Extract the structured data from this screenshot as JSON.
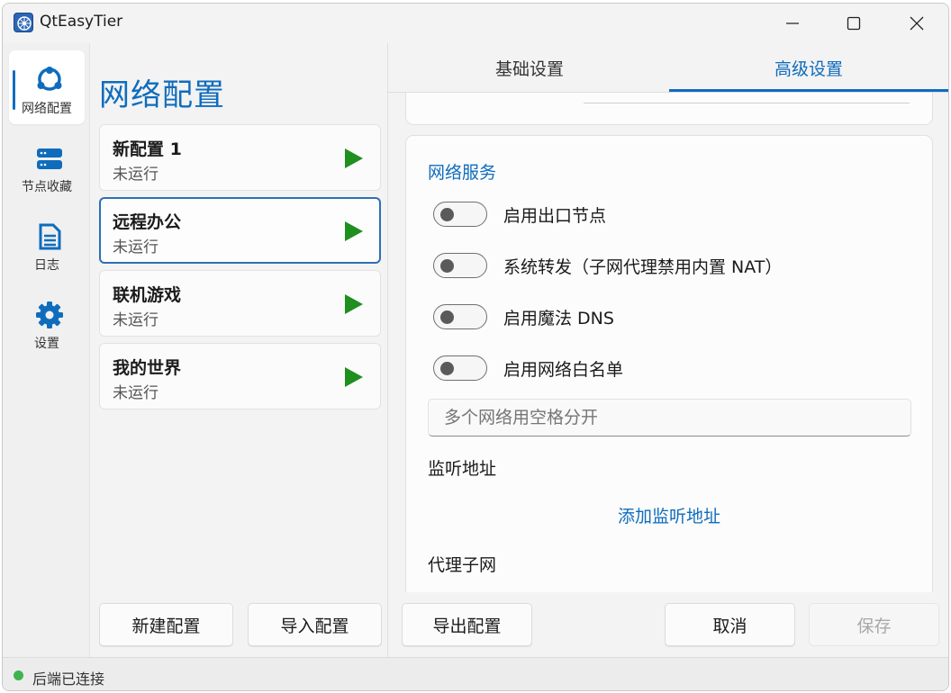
{
  "window": {
    "title": "QtEasyTier"
  },
  "nav": {
    "items": [
      {
        "label": "网络配置",
        "icon": "network-config-icon",
        "active": true
      },
      {
        "label": "节点收藏",
        "icon": "server-icon",
        "active": false
      },
      {
        "label": "日志",
        "icon": "log-document-icon",
        "active": false
      },
      {
        "label": "设置",
        "icon": "gear-icon",
        "active": false
      }
    ]
  },
  "config_panel": {
    "title": "网络配置",
    "configs": [
      {
        "name": "新配置 1",
        "status": "未运行",
        "selected": false
      },
      {
        "name": "远程办公",
        "status": "未运行",
        "selected": true
      },
      {
        "name": "联机游戏",
        "status": "未运行",
        "selected": false
      },
      {
        "name": "我的世界",
        "status": "未运行",
        "selected": false
      }
    ],
    "new_button": "新建配置",
    "import_button": "导入配置"
  },
  "right_panel": {
    "tabs": [
      {
        "label": "基础设置",
        "active": false
      },
      {
        "label": "高级设置",
        "active": true
      }
    ],
    "network_services": {
      "title": "网络服务",
      "toggles": [
        {
          "label": "启用出口节点",
          "on": false
        },
        {
          "label": "系统转发（子网代理禁用内置 NAT）",
          "on": false
        },
        {
          "label": "启用魔法 DNS",
          "on": false
        },
        {
          "label": "启用网络白名单",
          "on": false
        }
      ],
      "whitelist_placeholder": "多个网络用空格分开",
      "listen_heading": "监听地址",
      "add_listen_link": "添加监听地址",
      "proxy_heading": "代理子网"
    },
    "export_button": "导出配置",
    "cancel_button": "取消",
    "save_button": "保存"
  },
  "status": {
    "text": "后端已连接",
    "color": "#3fb34f"
  },
  "colors": {
    "accent": "#0f6cbd",
    "play": "#1f8f1f"
  }
}
